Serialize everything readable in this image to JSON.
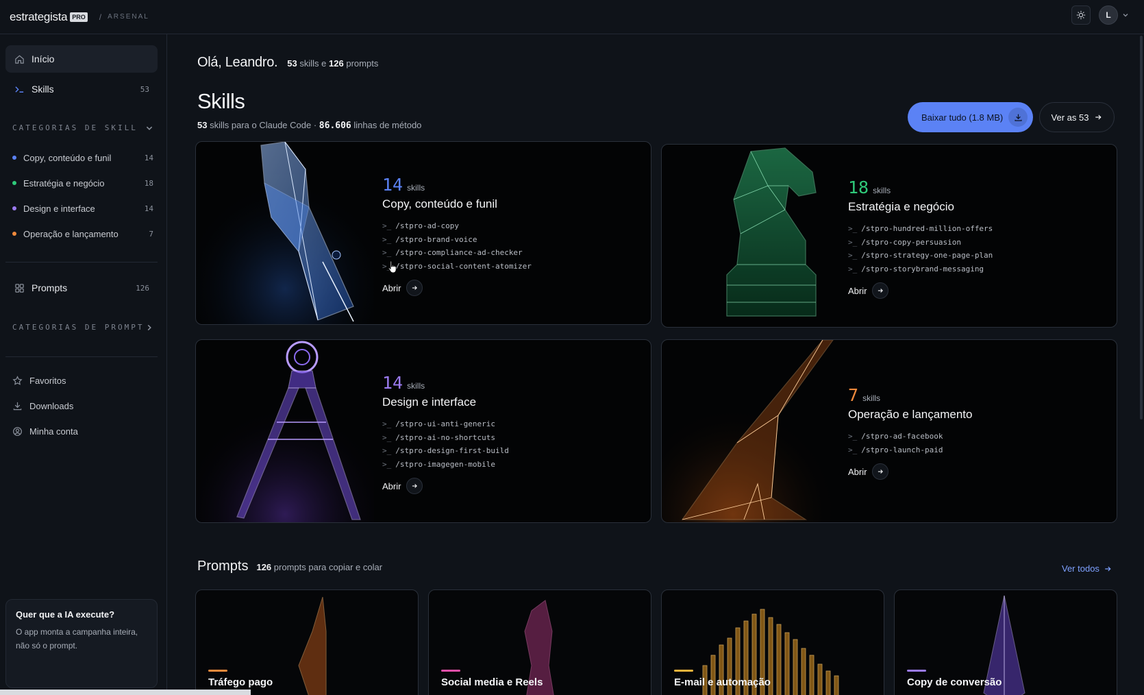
{
  "brand": {
    "name": "estrategista",
    "badge": "PRO",
    "separator": "/",
    "crumb": "ARSENAL"
  },
  "user": {
    "initial": "L"
  },
  "sidebar": {
    "home": {
      "label": "Início"
    },
    "skills": {
      "label": "Skills",
      "count": "53"
    },
    "skill_categories_title": "CATEGORIAS DE SKILL",
    "skill_categories": [
      {
        "label": "Copy, conteúdo e funil",
        "count": "14",
        "color": "#5b82f5"
      },
      {
        "label": "Estratégia e negócio",
        "count": "18",
        "color": "#2fca7a"
      },
      {
        "label": "Design e interface",
        "count": "14",
        "color": "#9b7bf0"
      },
      {
        "label": "Operação e lançamento",
        "count": "7",
        "color": "#f08a3c"
      }
    ],
    "prompts": {
      "label": "Prompts",
      "count": "126"
    },
    "prompt_categories_title": "CATEGORIAS DE PROMPT",
    "favorites": "Favoritos",
    "downloads": "Downloads",
    "account": "Minha conta",
    "promo": {
      "title": "Quer que a IA execute?",
      "text": "O app monta a campanha inteira, não só o prompt."
    }
  },
  "greeting": {
    "title": "Olá, Leandro.",
    "skills_count": "53",
    "skills_word": "skills e",
    "prompts_count": "126",
    "prompts_word": "prompts"
  },
  "skills_section": {
    "title": "Skills",
    "sub_count": "53",
    "sub_text": "skills para o Claude Code ·",
    "sub_lines": "86.606",
    "sub_lines_text": "linhas de método",
    "download_btn": "Baixar tudo (1.8 MB)",
    "see_btn": "Ver as 53"
  },
  "skill_cards": [
    {
      "count": "14",
      "unit": "skills",
      "title": "Copy, conteúdo e funil",
      "color": "#5b82f5",
      "commands": [
        "/stpro-ad-copy",
        "/stpro-brand-voice",
        "/stpro-compliance-ad-checker",
        "/stpro-social-content-atomizer"
      ],
      "open": "Abrir"
    },
    {
      "count": "18",
      "unit": "skills",
      "title": "Estratégia e negócio",
      "color": "#2fca7a",
      "commands": [
        "/stpro-hundred-million-offers",
        "/stpro-copy-persuasion",
        "/stpro-strategy-one-page-plan",
        "/stpro-storybrand-messaging"
      ],
      "open": "Abrir"
    },
    {
      "count": "14",
      "unit": "skills",
      "title": "Design e interface",
      "color": "#9b7bf0",
      "commands": [
        "/stpro-ui-anti-generic",
        "/stpro-ai-no-shortcuts",
        "/stpro-design-first-build",
        "/stpro-imagegen-mobile"
      ],
      "open": "Abrir"
    },
    {
      "count": "7",
      "unit": "skills",
      "title": "Operação e lançamento",
      "color": "#f08a3c",
      "commands": [
        "/stpro-ad-facebook",
        "/stpro-launch-paid"
      ],
      "open": "Abrir"
    }
  ],
  "prompts_section": {
    "title": "Prompts",
    "count": "126",
    "sub_text": "prompts para copiar e colar",
    "see_all": "Ver todos"
  },
  "prompt_cards": [
    {
      "title": "Tráfego pago",
      "color": "#f08a3c"
    },
    {
      "title": "Social media e Reels",
      "color": "#e34fa8"
    },
    {
      "title": "E-mail e automação",
      "color": "#f0b43c"
    },
    {
      "title": "Copy de conversão",
      "color": "#9b7bf0"
    }
  ],
  "prompt_prefix": ">_"
}
